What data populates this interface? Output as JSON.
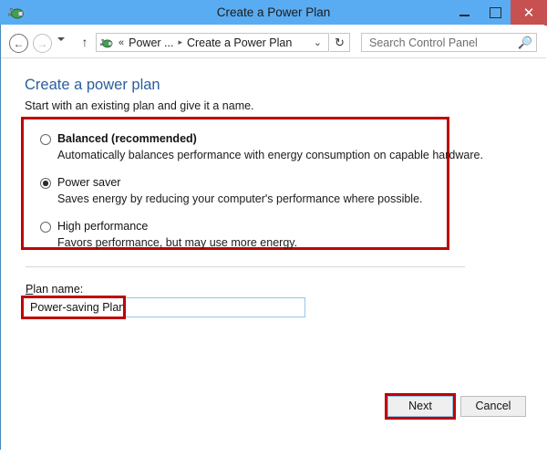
{
  "window": {
    "title": "Create a Power Plan",
    "icon": "power-plug-icon",
    "controls": {
      "minimize": "Minimize",
      "maximize": "Maximize",
      "close": "Close",
      "close_glyph": "✕"
    }
  },
  "navbar": {
    "back": "←",
    "forward": "→",
    "recent_pages": "Recent pages",
    "up": "↑",
    "address": {
      "icon": "power-plug-icon",
      "overflow_chevron": "«",
      "segments": [
        "Power ...",
        "Create a Power Plan"
      ],
      "separator": "▸",
      "dropdown": "⌄"
    },
    "refresh": "↻",
    "search": {
      "placeholder": "Search Control Panel",
      "value": "",
      "icon": "search-icon"
    }
  },
  "main": {
    "title": "Create a power plan",
    "subtitle": "Start with an existing plan and give it a name.",
    "plans": [
      {
        "label": "Balanced (recommended)",
        "description": "Automatically balances performance with energy consumption on capable hardware.",
        "selected": false,
        "bold": true
      },
      {
        "label": "Power saver",
        "description": "Saves energy by reducing your computer's performance where possible.",
        "selected": true,
        "bold": false
      },
      {
        "label": "High performance",
        "description": "Favors performance, but may use more energy.",
        "selected": false,
        "bold": false
      }
    ],
    "plan_name": {
      "label_accesskey": "P",
      "label_rest": "lan name:",
      "value": "Power-saving Plan",
      "placeholder": ""
    },
    "buttons": {
      "next": "Next",
      "cancel": "Cancel"
    }
  },
  "highlights": {
    "color": "#c00000"
  }
}
